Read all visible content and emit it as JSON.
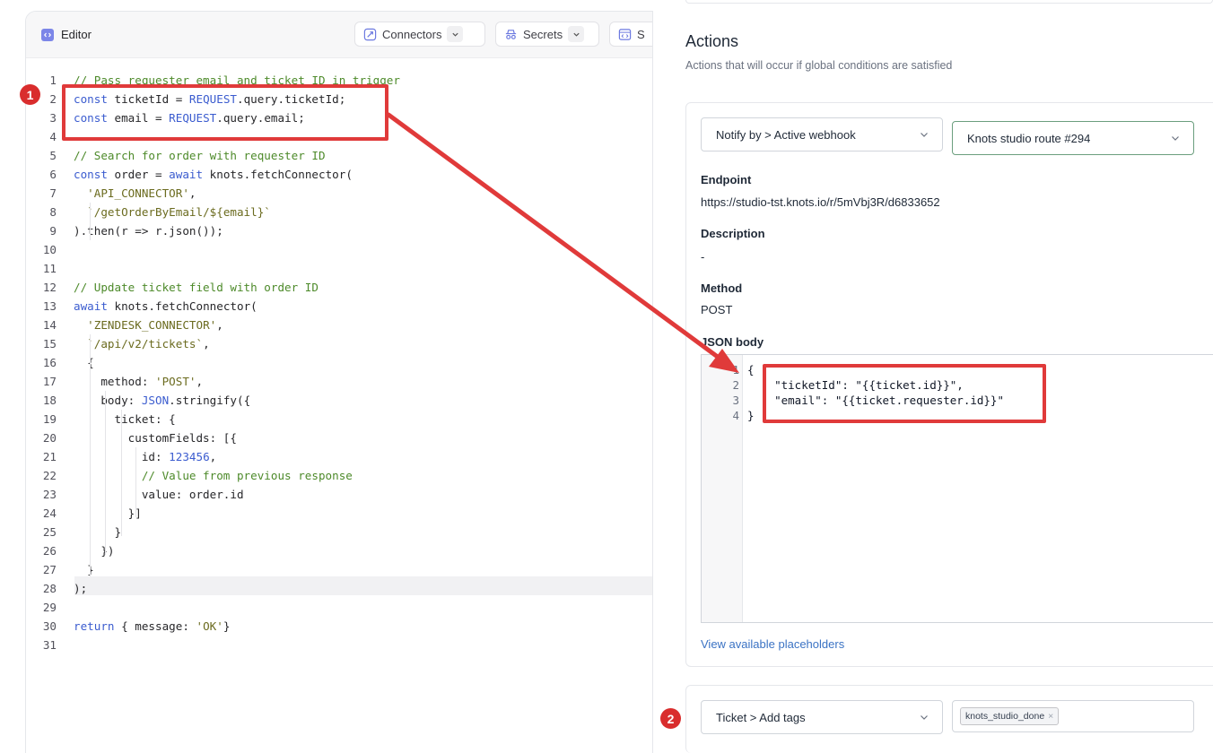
{
  "editor": {
    "title": "Editor",
    "buttons": {
      "connectors": "Connectors",
      "secrets": "Secrets",
      "third": "S"
    },
    "lines": [
      {
        "n": "1",
        "text": "// Pass requester email and ticket ID in trigger"
      },
      {
        "n": "2",
        "text": "const ticketId = REQUEST.query.ticketId;"
      },
      {
        "n": "3",
        "text": "const email = REQUEST.query.email;"
      },
      {
        "n": "4",
        "text": ""
      },
      {
        "n": "5",
        "text": "// Search for order with requester ID"
      },
      {
        "n": "6",
        "text": "const order = await knots.fetchConnector("
      },
      {
        "n": "7",
        "text": "  'API_CONNECTOR',"
      },
      {
        "n": "8",
        "text": "  `/getOrderByEmail/${email}`"
      },
      {
        "n": "9",
        "text": ").then(r => r.json());"
      },
      {
        "n": "10",
        "text": ""
      },
      {
        "n": "11",
        "text": ""
      },
      {
        "n": "12",
        "text": "// Update ticket field with order ID"
      },
      {
        "n": "13",
        "text": "await knots.fetchConnector("
      },
      {
        "n": "14",
        "text": "  'ZENDESK_CONNECTOR',"
      },
      {
        "n": "15",
        "text": "  `/api/v2/tickets`,"
      },
      {
        "n": "16",
        "text": "  {"
      },
      {
        "n": "17",
        "text": "    method: 'POST',"
      },
      {
        "n": "18",
        "text": "    body: JSON.stringify({"
      },
      {
        "n": "19",
        "text": "      ticket: {"
      },
      {
        "n": "20",
        "text": "        customFields: [{"
      },
      {
        "n": "21",
        "text": "          id: 123456,"
      },
      {
        "n": "22",
        "text": "          // Value from previous response"
      },
      {
        "n": "23",
        "text": "          value: order.id"
      },
      {
        "n": "24",
        "text": "        }]"
      },
      {
        "n": "25",
        "text": "      }"
      },
      {
        "n": "26",
        "text": "    })"
      },
      {
        "n": "27",
        "text": "  }"
      },
      {
        "n": "28",
        "text": ");"
      },
      {
        "n": "29",
        "text": ""
      },
      {
        "n": "30",
        "text": "return { message: 'OK'}"
      },
      {
        "n": "31",
        "text": ""
      }
    ]
  },
  "actions": {
    "title": "Actions",
    "subtitle": "Actions that will occur if global conditions are satisfied",
    "action1": {
      "type_select": "Notify by > Active webhook",
      "target_select": "Knots studio route #294",
      "endpoint_label": "Endpoint",
      "endpoint_value": "https://studio-tst.knots.io/r/5mVbj3R/d6833652",
      "description_label": "Description",
      "description_value": "-",
      "method_label": "Method",
      "method_value": "POST",
      "json_label": "JSON body",
      "json_lines": [
        {
          "n": "1",
          "text": "{"
        },
        {
          "n": "2",
          "text": "    \"ticketId\": \"{{ticket.id}}\","
        },
        {
          "n": "3",
          "text": "    \"email\": \"{{ticket.requester.id}}\""
        },
        {
          "n": "4",
          "text": "}"
        }
      ],
      "placeholders_link": "View available placeholders"
    },
    "action2": {
      "type_select": "Ticket > Add tags",
      "tag": "knots_studio_done",
      "tag_remove": "×"
    }
  },
  "annotations": {
    "badge1": "1",
    "badge2": "2",
    "color": "#e03a3a"
  }
}
